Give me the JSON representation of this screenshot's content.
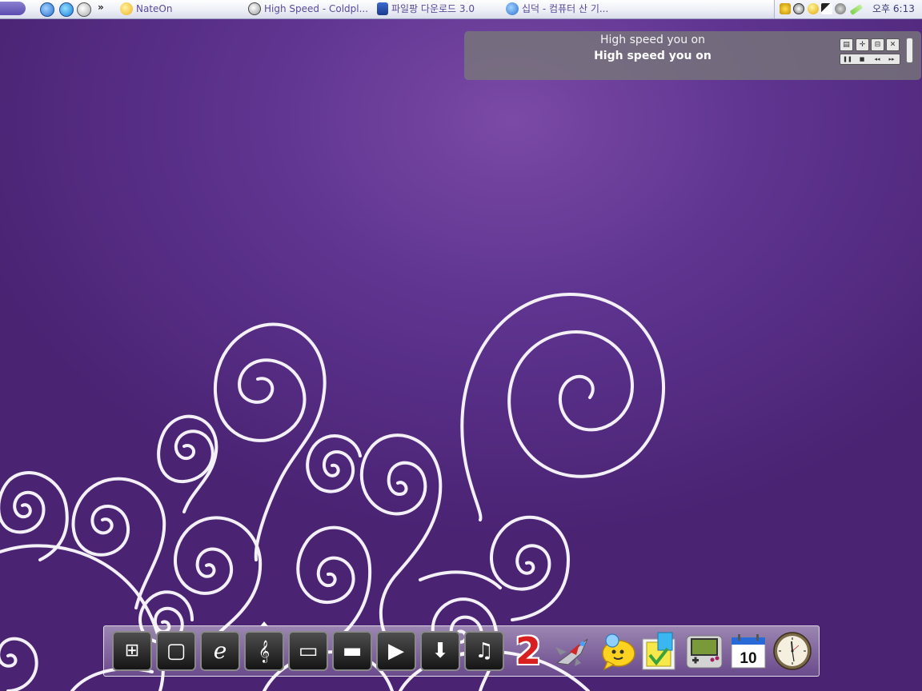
{
  "taskbar": {
    "quick_launch": [
      {
        "name": "ie-refresh-icon"
      },
      {
        "name": "internet-explorer-icon"
      },
      {
        "name": "itunes-icon"
      }
    ],
    "overflow_label": "»",
    "tasks": [
      {
        "label": "NateOn",
        "icon": "nateon-icon"
      },
      {
        "label": "High Speed - Coldpl...",
        "icon": "itunes-icon"
      },
      {
        "label": "파일팡 다운로드 3.0",
        "icon": "filepang-icon"
      },
      {
        "label": "십덕 - 컴퓨터 산 기...",
        "icon": "internet-explorer-icon"
      }
    ],
    "tray": {
      "clock": "오후 6:13",
      "icons": [
        "security-shield-icon",
        "itunes-icon",
        "smiley-icon",
        "network-icon",
        "audio-icon",
        "pen-icon"
      ]
    }
  },
  "lyrics_widget": {
    "line1": "High speed you on",
    "line2": "High speed you on",
    "buttons": {
      "toggle": "▤",
      "move": "✛",
      "minimize": "⊟",
      "close": "✕"
    },
    "controls": {
      "pause": "❚❚",
      "stop": "■",
      "prev": "◂◂",
      "next": "▸▸"
    }
  },
  "dock": {
    "items": [
      {
        "name": "windows",
        "glyph": "⊞"
      },
      {
        "name": "square",
        "glyph": "▢"
      },
      {
        "name": "internet-explorer",
        "glyph": "e"
      },
      {
        "name": "music-folder",
        "glyph": "𝄞"
      },
      {
        "name": "monitor",
        "glyph": "▭"
      },
      {
        "name": "folder",
        "glyph": "▬"
      },
      {
        "name": "play",
        "glyph": "▶"
      },
      {
        "name": "download",
        "glyph": "⬇"
      },
      {
        "name": "notes",
        "glyph": "♫"
      },
      {
        "name": "two",
        "glyph": "2"
      },
      {
        "name": "spaceship",
        "glyph": ""
      },
      {
        "name": "nateon",
        "glyph": ""
      },
      {
        "name": "sticky-notes",
        "glyph": ""
      },
      {
        "name": "gameboy",
        "glyph": ""
      },
      {
        "name": "calendar",
        "glyph": "10"
      },
      {
        "name": "clock",
        "glyph": ""
      }
    ]
  },
  "colors": {
    "wallpaper": "#5e3490",
    "swirl": "#ffffff",
    "taskbar_text": "#5a4a9a"
  }
}
